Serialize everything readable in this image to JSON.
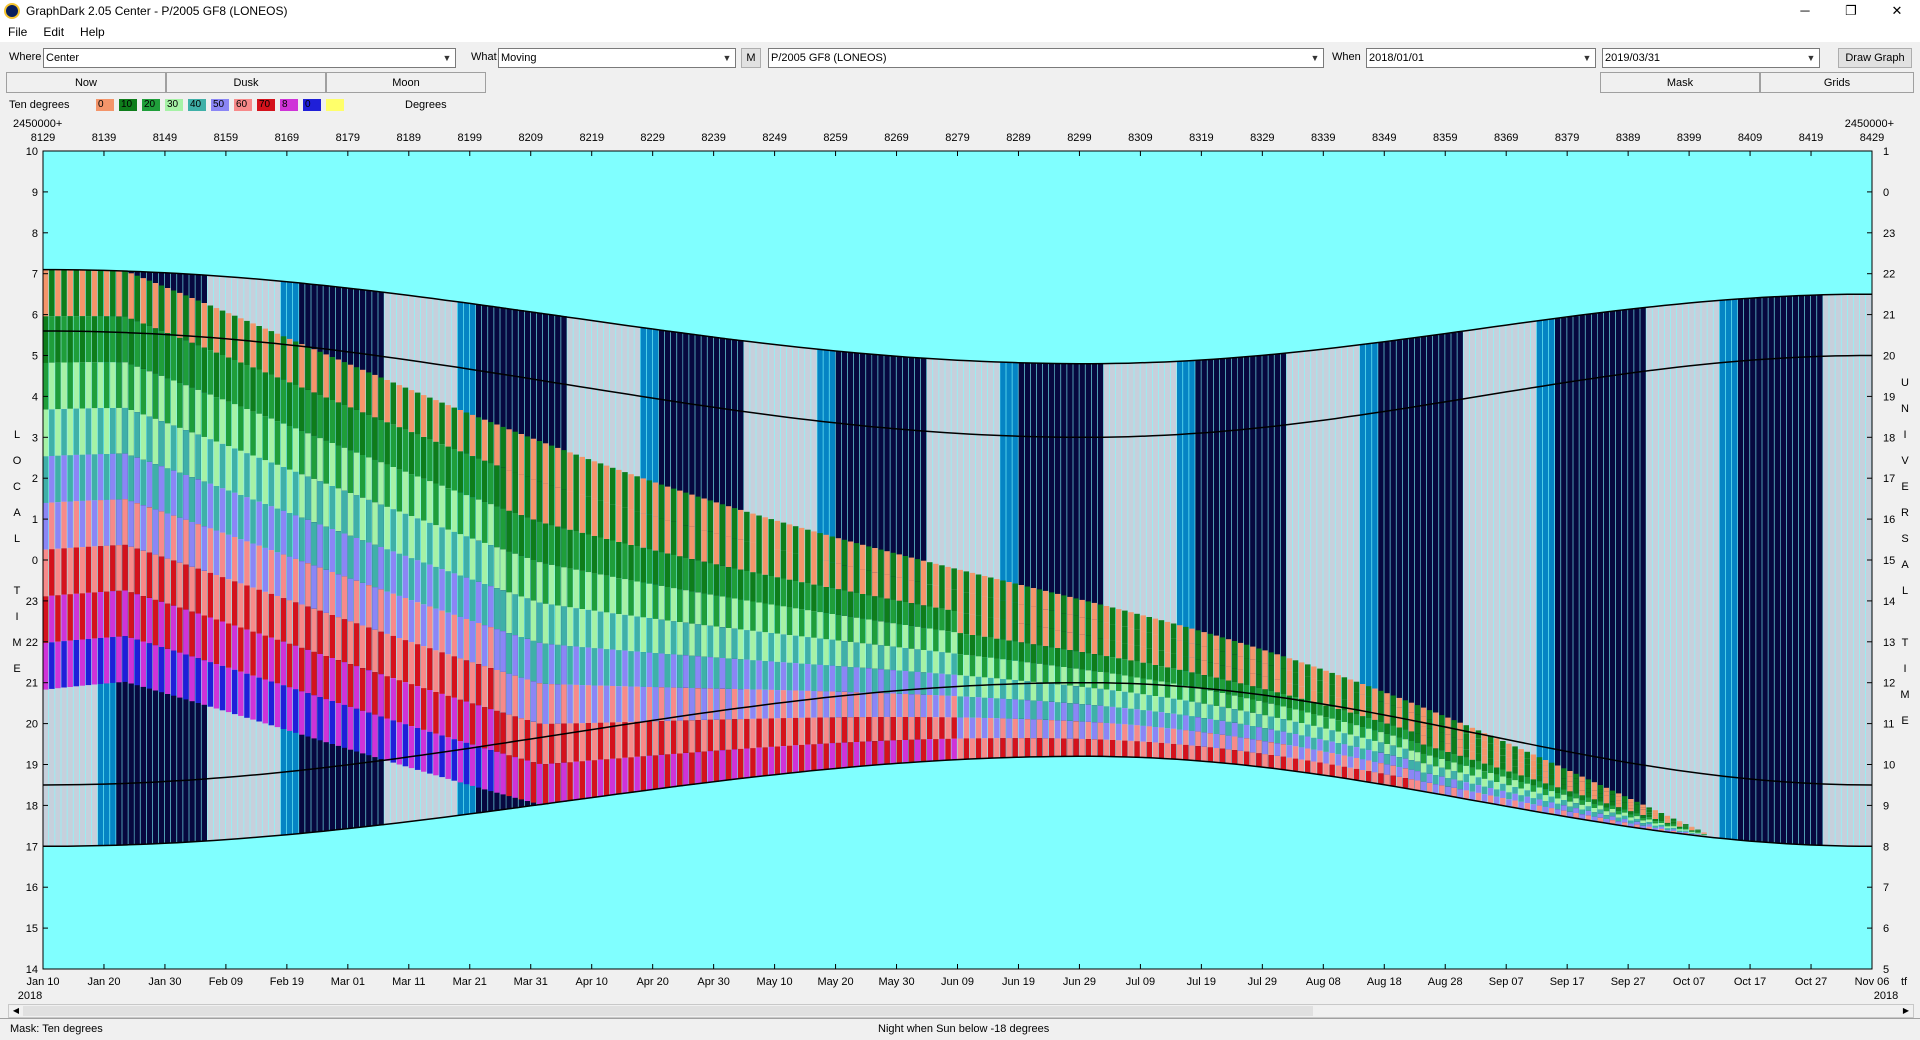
{
  "window": {
    "title": "GraphDark 2.05  Center  -  P/2005 GF8 (LONEOS)",
    "minimize": "─",
    "maximize": "❐",
    "close": "✕"
  },
  "menu": [
    "File",
    "Edit",
    "Help"
  ],
  "toolbar": {
    "where_label": "Where",
    "where_value": "Center",
    "what_label": "What",
    "what_value": "Moving",
    "m_button": "M",
    "object_value": "P/2005 GF8 (LONEOS)",
    "when_label": "When",
    "when_start": "2018/01/01",
    "when_end": "2019/03/31",
    "draw_button": "Draw Graph"
  },
  "tabs": {
    "now": "Now",
    "dusk": "Dusk",
    "moon": "Moon",
    "mask": "Mask",
    "grids": "Grids"
  },
  "legend": {
    "title": "Ten degrees",
    "units": "Degrees",
    "items": [
      {
        "label": "0",
        "color": "#f4956a"
      },
      {
        "label": "10",
        "color": "#0e7d1b"
      },
      {
        "label": "20",
        "color": "#1f9e3a"
      },
      {
        "label": "30",
        "color": "#a6f2a6"
      },
      {
        "label": "40",
        "color": "#3fb0a8"
      },
      {
        "label": "50",
        "color": "#8b86f5"
      },
      {
        "label": "60",
        "color": "#f78a8a"
      },
      {
        "label": "70",
        "color": "#d4121c"
      },
      {
        "label": "8",
        "color": "#cf33d8"
      },
      {
        "label": "0",
        "color": "#1f1fd8"
      },
      {
        "label": "",
        "color": "#ffff6a"
      }
    ]
  },
  "chart_data": {
    "type": "heatmap",
    "top_axis_prefix_left": "2450000+",
    "top_axis_prefix_right": "2450000+",
    "jd_ticks": [
      "8129",
      "8139",
      "8149",
      "8159",
      "8169",
      "8179",
      "8189",
      "8199",
      "8209",
      "8219",
      "8229",
      "8239",
      "8249",
      "8259",
      "8269",
      "8279",
      "8289",
      "8299",
      "8309",
      "8319",
      "8329",
      "8339",
      "8349",
      "8359",
      "8369",
      "8379",
      "8389",
      "8399",
      "8409",
      "8419",
      "8429"
    ],
    "date_ticks": [
      "Jan 10",
      "Jan 20",
      "Jan 30",
      "Feb 09",
      "Feb 19",
      "Mar 01",
      "Mar 11",
      "Mar 21",
      "Mar 31",
      "Apr 10",
      "Apr 20",
      "Apr 30",
      "May 10",
      "May 20",
      "May 30",
      "Jun 09",
      "Jun 19",
      "Jun 29",
      "Jul 09",
      "Jul 19",
      "Jul 29",
      "Aug 08",
      "Aug 18",
      "Aug 28",
      "Sep 07",
      "Sep 17",
      "Sep 27",
      "Oct 07",
      "Oct 17",
      "Oct 27",
      "Nov 06"
    ],
    "year_left": "2018",
    "year_right": "2018",
    "corner_right": "tf",
    "left_ticks": [
      "10",
      "9",
      "8",
      "7",
      "6",
      "5",
      "4",
      "3",
      "2",
      "1",
      "0",
      "23",
      "22",
      "21",
      "20",
      "19",
      "18",
      "17",
      "16",
      "15",
      "14"
    ],
    "right_ticks": [
      "1",
      "0",
      "23",
      "22",
      "21",
      "20",
      "19",
      "18",
      "17",
      "16",
      "15",
      "14",
      "13",
      "12",
      "11",
      "10",
      "9",
      "8",
      "7",
      "6",
      "5"
    ],
    "left_axis_label": "LOCAL TIME",
    "right_axis_label": "UNIVERSAL TIME",
    "y_range_hours": [
      14,
      34
    ],
    "night_upper_local": [
      [
        8129,
        7.1
      ],
      [
        8300,
        4.8
      ],
      [
        8429,
        6.5
      ]
    ],
    "night_lower_local": [
      [
        8129,
        17.0
      ],
      [
        8300,
        19.2
      ],
      [
        8429,
        17.0
      ]
    ],
    "astro_upper_local": [
      [
        8129,
        5.6
      ],
      [
        8300,
        3.0
      ],
      [
        8429,
        5.0
      ]
    ],
    "astro_lower_local": [
      [
        8129,
        18.5
      ],
      [
        8300,
        21.0
      ],
      [
        8429,
        18.5
      ]
    ],
    "colors": {
      "day": "#80ffff",
      "dark": "#07083f",
      "twilight": "#c6d0dc",
      "moon": "#0584c4"
    }
  },
  "status": {
    "mask": "Mask:  Ten degrees",
    "night": "Night when Sun below -18 degrees"
  }
}
